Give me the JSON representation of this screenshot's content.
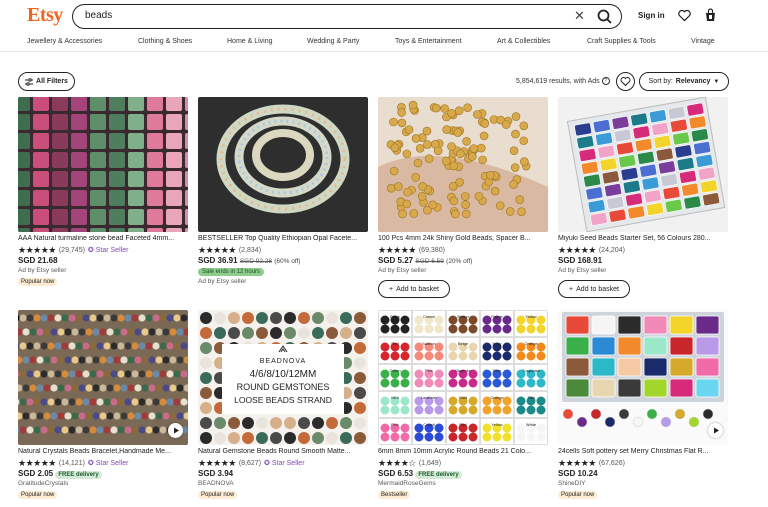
{
  "header": {
    "logo": "Etsy",
    "search_value": "beads",
    "signin_label": "Sign in"
  },
  "categories": [
    "Jewellery & Accessories",
    "Clothing & Shoes",
    "Home & Living",
    "Wedding & Party",
    "Toys & Entertainment",
    "Art & Collectibles",
    "Craft Supplies & Tools",
    "Vintage"
  ],
  "filters": {
    "all_filters_label": "All Filters",
    "results_text": "5,854,619 results, with Ads",
    "sort_prefix": "Sort by:",
    "sort_value": "Relevancy"
  },
  "listings": [
    {
      "title": "AAA Natural turmaline stone bead Faceted 4mm...",
      "stars": "★★★★★",
      "reviews": "(29,745)",
      "star_seller": "Star Seller",
      "price": "SGD 21.68",
      "ad_text": "Ad by Etsy seller",
      "badge": "Popular now"
    },
    {
      "title": "BESTSELLER Top Quality Ethiopian Opal Facete...",
      "stars": "★★★★★",
      "reviews": "(2,834)",
      "price": "SGD 36.91",
      "old_price": "SGD 92.28",
      "discount": "(60% off)",
      "sale": "Sale ends in 12 hours",
      "ad_text": "Ad by Etsy seller"
    },
    {
      "title": "100 Pcs 4mm 24k Shiny Gold Beads, Spacer B...",
      "stars": "★★★★★",
      "reviews": "(69,380)",
      "price": "SGD 5.27",
      "old_price": "SGD 6.59",
      "discount": "(20% off)",
      "ad_text": "Ad by Etsy seller",
      "basket": "Add to basket"
    },
    {
      "title": "Miyuki Seed Beads Starter Set, 56 Colours 280...",
      "stars": "★★★★★",
      "reviews": "(24,204)",
      "price": "SGD 168.91",
      "ad_text": "Ad by Etsy seller",
      "basket": "Add to basket"
    },
    {
      "title": "Natural Crystals Beads Bracelet,Handmade Me...",
      "stars": "★★★★★",
      "reviews": "(14,121)",
      "star_seller": "Star Seller",
      "free_delivery": "FREE delivery",
      "price": "SGD 2.05",
      "shop": "GratitudeCrystals",
      "badge": "Popular now"
    },
    {
      "title": "Natural Gemstone Beads Round Smooth Matte...",
      "stars": "★★★★★",
      "reviews": "(8,627)",
      "star_seller": "Star Seller",
      "price": "SGD 3.94",
      "shop": "BEADNOVA",
      "badge": "Popular now"
    },
    {
      "title": "6mm 8mm 10mm Acrylic Round Beads 21 Colo...",
      "stars": "★★★★☆",
      "reviews": "(1,649)",
      "free_delivery": "FREE delivery",
      "price": "SGD 6.53",
      "shop": "MermaidRoseGems",
      "badge": "Bestseller"
    },
    {
      "title": "24cells Soft pottery set Merry Christmas Flat R...",
      "stars": "★★★★★",
      "reviews": "(67,626)",
      "price": "SGD 10.24",
      "shop": "ShineDIY",
      "badge": "Popular now"
    }
  ],
  "image_text": {
    "beadnova_brand": "BEADNOVA",
    "beadnova_sizes": "4/6/8/10/12MM",
    "beadnova_line2": "ROUND GEMSTONES",
    "beadnova_line3": "LOOSE BEADS STRAND",
    "acrylic_colors": [
      "Black",
      "Cream",
      "Brown",
      "Purple",
      "Yellow",
      "Red",
      "Salmon",
      "Beige",
      "Navy",
      "Orange",
      "Green",
      "Pink",
      "Magenta",
      "Blue",
      "Turquoise",
      "Mint",
      "Lavender",
      "Gold",
      "Orange",
      "Teal",
      "Pink",
      "Cobalt",
      "Red",
      "Yellow",
      "White"
    ]
  },
  "colors": {
    "brand": "#f1641e",
    "star_seller": "#7f4ab8",
    "sale_green": "#8fcc8f"
  }
}
